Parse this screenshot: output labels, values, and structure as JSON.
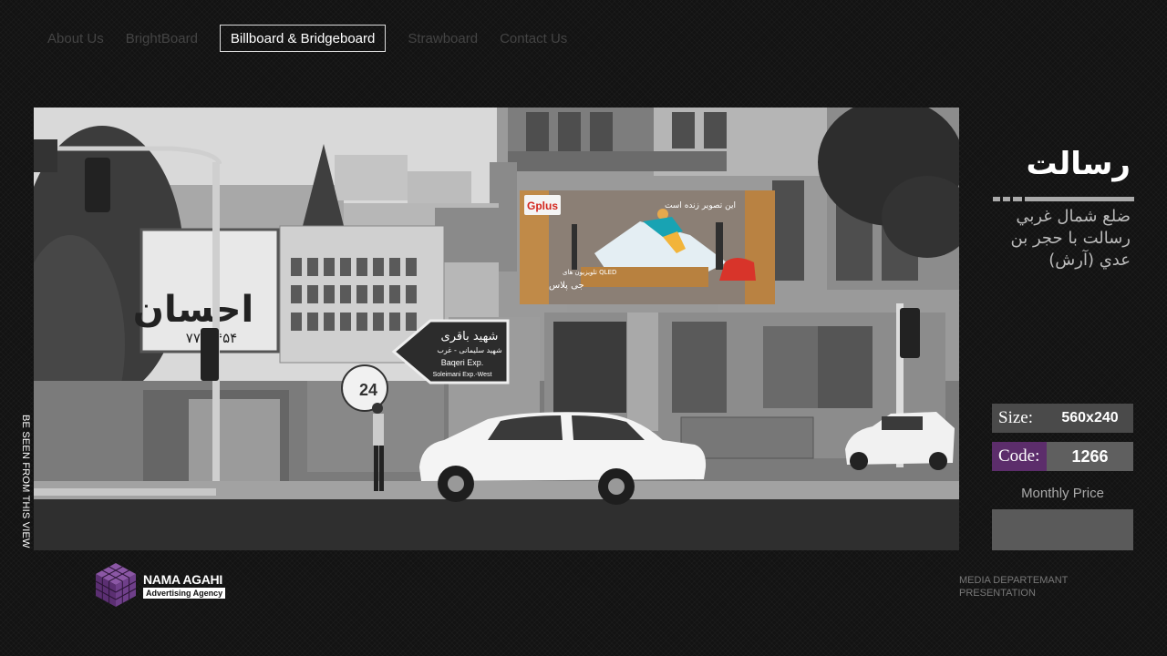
{
  "nav": {
    "items": [
      {
        "label": "About Us",
        "active": false
      },
      {
        "label": "BrightBoard",
        "active": false
      },
      {
        "label": "Billboard & Bridgeboard",
        "active": true
      },
      {
        "label": "Strawboard",
        "active": false
      },
      {
        "label": "Contact Us",
        "active": false
      }
    ]
  },
  "photo": {
    "caption": "BE SEEN FROM THIS VIEW",
    "billboard_brand": "Gplus",
    "billboard_headline": "این تصویر زنده است",
    "billboard_sub": "تلویزیون های QLED",
    "billboard_brand_fa": "جی پلاس",
    "road_sign_fa_1": "شهید باقری",
    "road_sign_fa_2": "شهید سلیمانی - غرب",
    "road_sign_en_1": "Baqeri Exp.",
    "road_sign_en_2": "Soleimani Exp.-West",
    "building_sign_fa": "احسان",
    "building_phone": "۷۷۰۵۴۵۴"
  },
  "location": {
    "title": "رسالت",
    "address": "ضلع شمال غربي رسالت با حجر بن عدي (آرش)"
  },
  "specs": {
    "size_label": "Size:",
    "size_value": "560x240",
    "code_label": "Code:",
    "code_value": "1266",
    "price_label": "Monthly Price",
    "price_value": ""
  },
  "footer": {
    "logo_name": "NAMA AGAHI",
    "logo_tag": "Advertising Agency",
    "media_line1": "MEDIA DEPARTEMANT",
    "media_line2": "PRESENTATION"
  },
  "colors": {
    "background": "#131313",
    "code_accent": "#5c2d6b",
    "logo_purple": "#6a3a86"
  }
}
